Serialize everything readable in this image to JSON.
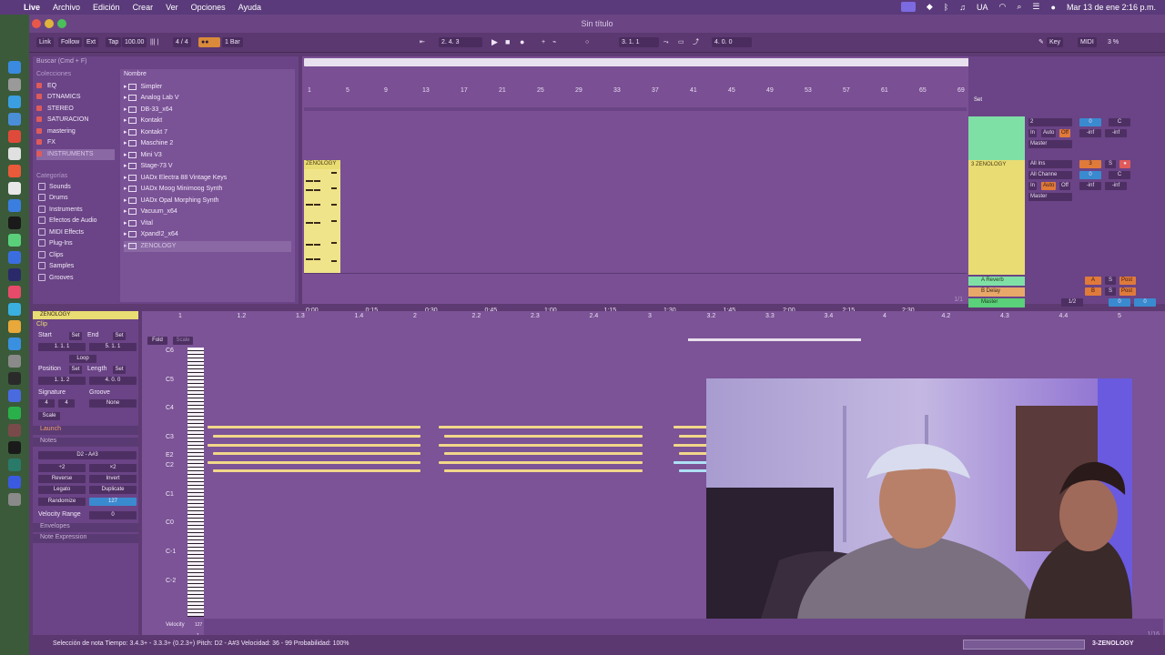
{
  "menubar": {
    "app": "Live",
    "items": [
      "Archivo",
      "Edición",
      "Crear",
      "Ver",
      "Opciones",
      "Ayuda"
    ],
    "status_ua": "UA",
    "clock": "Mar 13 de ene  2:16 p.m."
  },
  "window": {
    "title": "Sin título"
  },
  "transport": {
    "link": "Link",
    "follow": "Follow",
    "ext": "Ext",
    "tap": "Tap",
    "tempo": "100.00",
    "signature": "4 / 4",
    "quantize": "1 Bar",
    "arrangement_position": "2.   4.   3",
    "loop_start": "3.   1.   1",
    "loop_length": "4.   0.   0",
    "key": "Key",
    "midi": "MIDI",
    "cpu": "3 %"
  },
  "browser": {
    "search_placeholder": "Buscar (Cmd + F)",
    "collections_header": "Colecciones",
    "collections": [
      "EQ",
      "DTNAMICS",
      "STEREO",
      "SATURACION",
      "mastering",
      "FX",
      "INSTRUMENTS"
    ],
    "categories_header": "Categorías",
    "categories": [
      "Sounds",
      "Drums",
      "Instruments",
      "Efectos de Audio",
      "MIDI Effects",
      "Plug-Ins",
      "Clips",
      "Samples",
      "Grooves"
    ],
    "name_header": "Nombre",
    "items": [
      "Simpler",
      "Analog Lab V",
      "DB-33_x64",
      "Kontakt",
      "Kontakt 7",
      "Maschine 2",
      "Mini V3",
      "Stage-73 V",
      "UADx Electra 88 Vintage Keys",
      "UADx Moog Minimoog Synth",
      "UADx Opal Morphing Synth",
      "Vacuum_x64",
      "Vital",
      "Xpand!2_x64",
      "ZENOLOGY"
    ]
  },
  "arrangement": {
    "bar_numbers": [
      "1",
      "5",
      "9",
      "13",
      "17",
      "21",
      "25",
      "29",
      "33",
      "37",
      "41",
      "45",
      "49",
      "53",
      "57",
      "61",
      "65",
      "69"
    ],
    "clip_name": "ZENOLOGY",
    "time_labels": [
      "0:00",
      "0:15",
      "0:30",
      "0:45",
      "1:00",
      "1:15",
      "1:30",
      "1:45",
      "2:00",
      "2:15",
      "2:30"
    ],
    "page": "1/1"
  },
  "mixer": {
    "set_label": "Set",
    "track2": {
      "num": "2",
      "routing": "Master",
      "vol": "0",
      "pan": "C",
      "in": "In",
      "auto": "Auto",
      "off": "Off",
      "meter": "-inf"
    },
    "track3": {
      "name": "3 ZENOLOGY",
      "input": "All Ins",
      "channel": "All Channe",
      "routing": "Master",
      "num": "3",
      "vol": "0",
      "pan": "C",
      "s": "S",
      "in": "In",
      "auto": "Auto",
      "off": "Off",
      "meter": "-inf"
    },
    "returns": [
      {
        "name": "A Reverb",
        "letter": "A",
        "s": "S",
        "post": "Post"
      },
      {
        "name": "B Delay",
        "letter": "B",
        "s": "S",
        "post": "Post"
      }
    ],
    "master": {
      "name": "Master",
      "cue": "1/2",
      "vol": "0",
      "pan": "0"
    }
  },
  "clipview": {
    "name": "ZENOLOGY",
    "clip": "Clip",
    "start": "Start",
    "set": "Set",
    "end": "End",
    "start_val": "1.   1.   1",
    "end_val": "5.   1.   1",
    "loop": "Loop",
    "position": "Position",
    "length": "Length",
    "position_val": "1.   1.   2",
    "length_val": "4.   0.   0",
    "signature": "Signature",
    "groove": "Groove",
    "sig_num": "4",
    "sig_den": "4",
    "groove_val": "None",
    "scale": "Scale",
    "launch": "Launch",
    "notes": "Notes",
    "range": "D2 - A#3",
    "halve": "÷2",
    "double": "×2",
    "reverse": "Reverse",
    "invert": "Invert",
    "legato": "Legato",
    "duplicate": "Duplicate",
    "randomize": "Randomize",
    "randomize_val": "127",
    "velocity_range": "Velocity Range",
    "velocity_range_val": "0",
    "envelopes": "Envelopes",
    "expression": "Note Expression"
  },
  "midieditor": {
    "fold": "Fold",
    "scale": "Scale",
    "beats": [
      "1",
      "1.2",
      "1.3",
      "1.4",
      "2",
      "2.2",
      "2.3",
      "2.4",
      "3",
      "3.2",
      "3.3",
      "3.4",
      "4",
      "4.2",
      "4.3",
      "4.4",
      "5"
    ],
    "pitches": [
      "C6",
      "C5",
      "C4",
      "C3",
      "E2",
      "C2",
      "C1",
      "C0",
      "C-1",
      "C-2"
    ],
    "velocity": "Velocity",
    "vel_max": "127",
    "vel_min": "1",
    "page": "1/16"
  },
  "statusbar": {
    "text": "Selección de nota   Tiempo: 3.4.3+ - 3.3.3+ (0.2.3+)   Pitch: D2 - A#3   Velocidad: 36 - 99   Probabilidad: 100%",
    "track": "3-ZENOLOGY"
  },
  "colors": {
    "track_green": "#7fe0a6",
    "track_yellow": "#e8dc72",
    "accent_orange": "#e07a3a",
    "bg_purple": "#7a4f94"
  }
}
